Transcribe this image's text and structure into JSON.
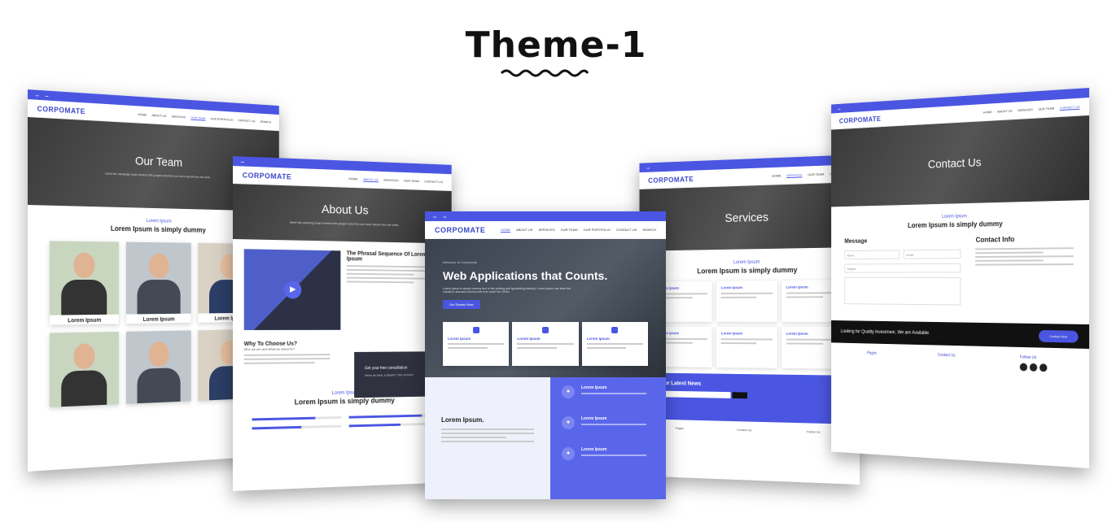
{
  "heading": "Theme-1",
  "brand": "CORPOMATE",
  "menu": [
    "HOME",
    "ABOUT US",
    "SERVICES",
    "OUR TEAM",
    "OUR PORTFOLIO",
    "CONTACT US",
    "SEARCH"
  ],
  "team_page": {
    "hero_title": "Our Team",
    "hero_text": "Used the campaign team behind this project and find out more about how we work.",
    "section_sub": "Lorem Ipsum",
    "section_title": "Lorem Ipsum is simply dummy",
    "members": [
      "Lorem Ipsum",
      "Lorem Ipsum",
      "Lorem Ipsum"
    ]
  },
  "about_page": {
    "hero_title": "About Us",
    "hero_text": "Meet the amazing team behind this project and find out more about how we work.",
    "heading": "The Phrasal Sequence Of Lorem Ipsum",
    "why_title": "Why To Choose Us?",
    "why_sub": "Who we are and What we stand for?",
    "promo": "Get your free consultation",
    "promo_sub": "Have an idea, a dream? Tell us more",
    "skills_sub": "Lorem Ipsum",
    "skills_title": "Lorem Ipsum is simply dummy"
  },
  "home_page": {
    "welcome": "Welcome to Corpomate",
    "hero_title": "Web Applications that Counts.",
    "hero_text": "Lorem Ipsum is simply dummy text of the printing and typesetting industry. Lorem Ipsum has been the industry's standard dummy text ever since the 1500s.",
    "hero_button": "Get Started Now",
    "features": [
      "Lorem Ipsum",
      "Lorem Ipsum",
      "Lorem Ipsum"
    ],
    "lower_title": "Lorem Ipsum.",
    "right_items": [
      "Lorem Ipsum",
      "Lorem Ipsum",
      "Lorem Ipsum"
    ]
  },
  "services_page": {
    "hero_title": "Services",
    "section_sub": "Lorem Ipsum",
    "section_title": "Lorem Ipsum is simply dummy",
    "items": [
      "Lorem Ipsum",
      "Lorem Ipsum",
      "Lorem Ipsum",
      "Lorem Ipsum",
      "Lorem Ipsum",
      "Lorem Ipsum"
    ],
    "news_title": "Join For Latest News",
    "footer_cols": [
      "Pages",
      "Contact Us",
      "Follow Us"
    ]
  },
  "contact_page": {
    "hero_title": "Contact Us",
    "section_sub": "Lorem Ipsum",
    "section_title": "Lorem Ipsum is simply dummy",
    "form_title": "Message",
    "name_placeholder": "Name",
    "email_placeholder": "Email",
    "subject_placeholder": "Subject",
    "info_title": "Contact Info",
    "cta_text": "Looking for Quality Investment, We are Available",
    "cta_button": "Contact Now",
    "footer_cols": [
      "Pages",
      "Contact Us",
      "Follow Us"
    ]
  }
}
